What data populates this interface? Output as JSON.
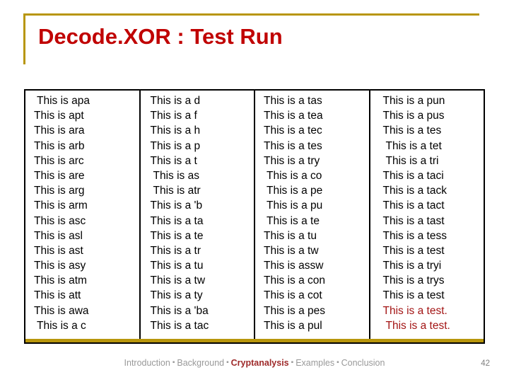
{
  "slide": {
    "title": "Decode.XOR : Test Run",
    "accent_color": "#b8960c",
    "title_color": "#c00000"
  },
  "table": {
    "columns": [
      {
        "name": "column-1",
        "cells": [
          " This is apa",
          "This is apt",
          "This is ara",
          "This is arb",
          "This is arc",
          "This is are",
          "This is arg",
          "This is arm",
          "This is asc",
          "This is asl",
          "This is ast",
          "This is asy",
          "This is atm",
          "This is att",
          "This is awa",
          " This is a c"
        ]
      },
      {
        "name": "column-2",
        "cells": [
          "This is a d",
          "This is a f",
          "This is a h",
          "This is a p",
          "This is a t",
          " This is as",
          " This is atr",
          "This is a 'b",
          "This is a ta",
          "This is a te",
          "This is a tr",
          "This is a tu",
          "This is a tw",
          "This is a ty",
          "This is a 'ba",
          "This is a tac"
        ]
      },
      {
        "name": "column-3",
        "cells": [
          "This is a tas",
          "This is a tea",
          "This is a tec",
          "This is a tes",
          "This is a try",
          " This is a co",
          " This is a pe",
          " This is a pu",
          " This is a te",
          "This is a tu",
          "This is a tw",
          "This is assw",
          "This is a con",
          "This is a cot",
          "This is a pes",
          "This is a pul"
        ]
      },
      {
        "name": "column-4",
        "cells": [
          "This is a pun",
          "This is a pus",
          "This is a tes",
          " This is a tet",
          " This is a tri",
          "This is a taci",
          "This is a tack",
          "This is a tact",
          "This is a tast",
          "This is a tess",
          "This is a test",
          "This is a tryi",
          "This is a trys",
          "This is a test",
          "This is a test.",
          " This is a test."
        ],
        "highlight_from": 14,
        "highlight_color": "#a31515"
      }
    ]
  },
  "footer": {
    "nav": [
      {
        "label": "Introduction",
        "active": false
      },
      {
        "label": "Background",
        "active": false
      },
      {
        "label": "Cryptanalysis",
        "active": true
      },
      {
        "label": "Examples",
        "active": false
      },
      {
        "label": "Conclusion",
        "active": false
      }
    ],
    "separator": "▪",
    "page_number": "42"
  }
}
